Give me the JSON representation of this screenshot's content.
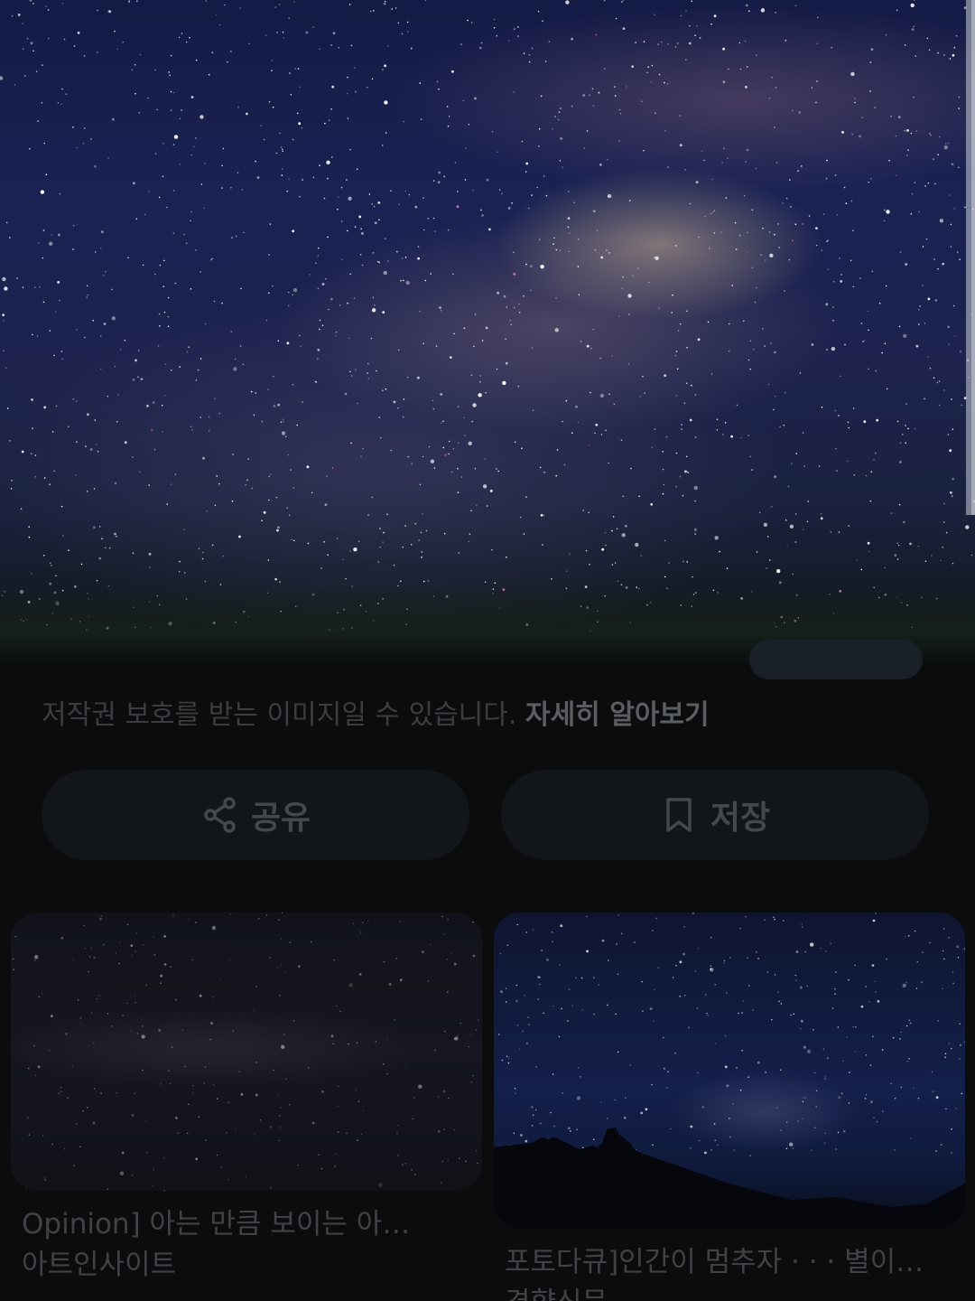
{
  "notice": {
    "text": "저작권 보호를 받는 이미지일 수 있습니다.",
    "link": "자세히 알아보기"
  },
  "actions": {
    "share_label": "공유",
    "save_label": "저장",
    "share_icon": "share-icon",
    "save_icon": "bookmark-icon"
  },
  "related": [
    {
      "title": "Opinion] 아는 만큼 보이는 아…",
      "source": "아트인사이트"
    },
    {
      "title": "포토다큐]인간이 멈추자 · · · 별이…",
      "source": "경향신문"
    }
  ],
  "colors": {
    "background": "#0b0c0d",
    "button_bg": "#12161a",
    "muted_text": "#3a3e42"
  }
}
